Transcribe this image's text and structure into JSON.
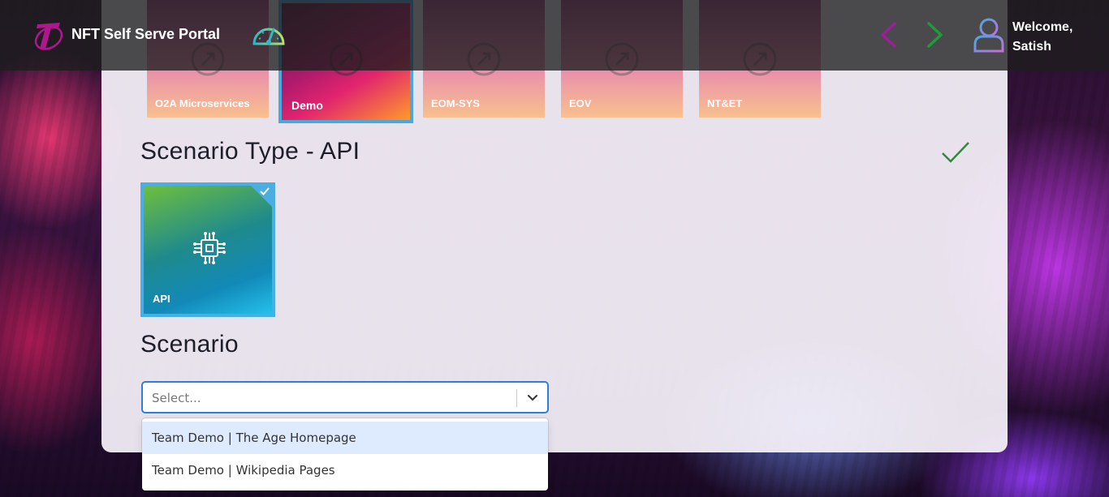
{
  "header": {
    "app_title": "NFT Self Serve Portal",
    "welcome_line1": "Welcome,",
    "welcome_line2": "Satish"
  },
  "projects": [
    {
      "label": "O2A Microservices",
      "selected": false
    },
    {
      "label": "Demo",
      "selected": true
    },
    {
      "label": "EOM-SYS",
      "selected": false
    },
    {
      "label": "EOV",
      "selected": false
    },
    {
      "label": "NT&ET",
      "selected": false
    }
  ],
  "scenario_type": {
    "title": "Scenario Type - API",
    "card_label": "API",
    "selected": true
  },
  "scenario": {
    "title": "Scenario",
    "select_placeholder": "Select...",
    "options": [
      "Team Demo | The Age Homepage",
      "Team Demo | Wikipedia Pages"
    ],
    "focused_option_index": 0
  },
  "colors": {
    "accent_blue": "#4aaee2",
    "select_border": "#2d7ed6",
    "check_green": "#2e8b3a",
    "nav_prev": "#9b1f9b",
    "nav_next": "#1f9b3a"
  }
}
